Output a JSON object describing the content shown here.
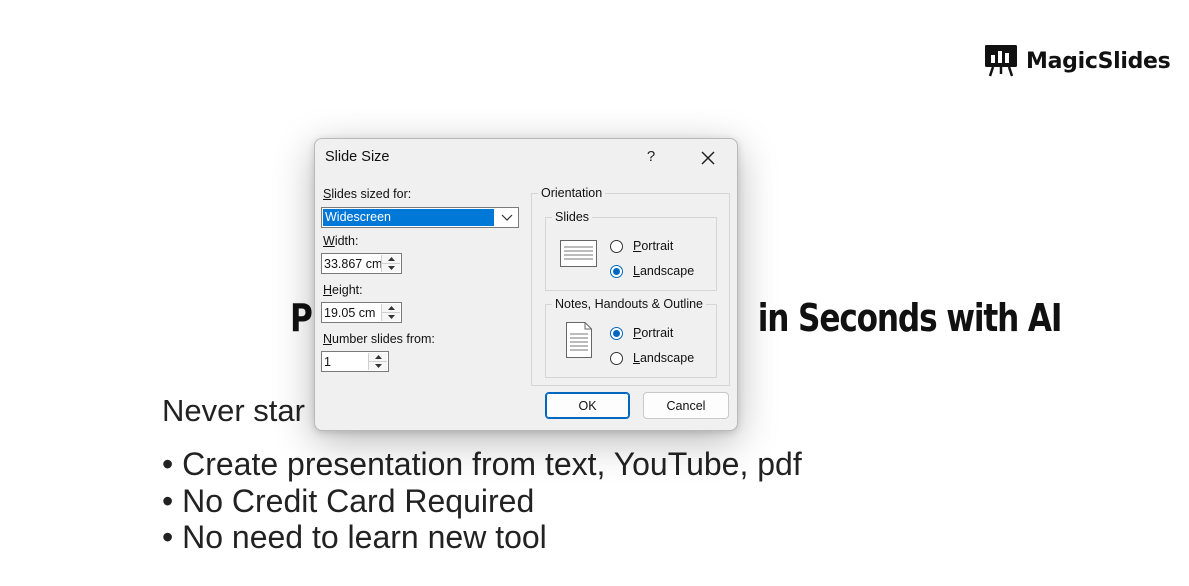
{
  "brand": {
    "name": "MagicSlides"
  },
  "background": {
    "headline_left": "P",
    "headline_right": "in Seconds with AI",
    "subline": "Never star",
    "bullets": [
      "• Create presentation from text, YouTube, pdf",
      "• No Credit Card Required",
      "• No need to learn new tool"
    ]
  },
  "dialog": {
    "title": "Slide Size",
    "help": "?",
    "slides_sized_for": {
      "label_u": "S",
      "label_rest": "lides sized for:",
      "value": "Widescreen"
    },
    "width": {
      "label_u": "W",
      "label_rest": "idth:",
      "value": "33.867 cm"
    },
    "height": {
      "label_u": "H",
      "label_rest": "eight:",
      "value": "19.05 cm"
    },
    "number_from": {
      "label_u": "N",
      "label_rest": "umber slides from:",
      "value": "1"
    },
    "orientation": {
      "label": "Orientation",
      "slides": {
        "label": "Slides",
        "options": [
          {
            "u": "P",
            "rest": "ortrait",
            "selected": false
          },
          {
            "u": "L",
            "rest": "andscape",
            "selected": true
          }
        ]
      },
      "notes": {
        "label": "Notes, Handouts & Outline",
        "options": [
          {
            "u": "P",
            "rest": "ortrait",
            "selected": true
          },
          {
            "u": "L",
            "rest": "andscape",
            "selected": false
          }
        ]
      }
    },
    "ok_label": "OK",
    "cancel_label": "Cancel"
  },
  "colors": {
    "accent": "#0067c0",
    "selection": "#0078d7"
  }
}
